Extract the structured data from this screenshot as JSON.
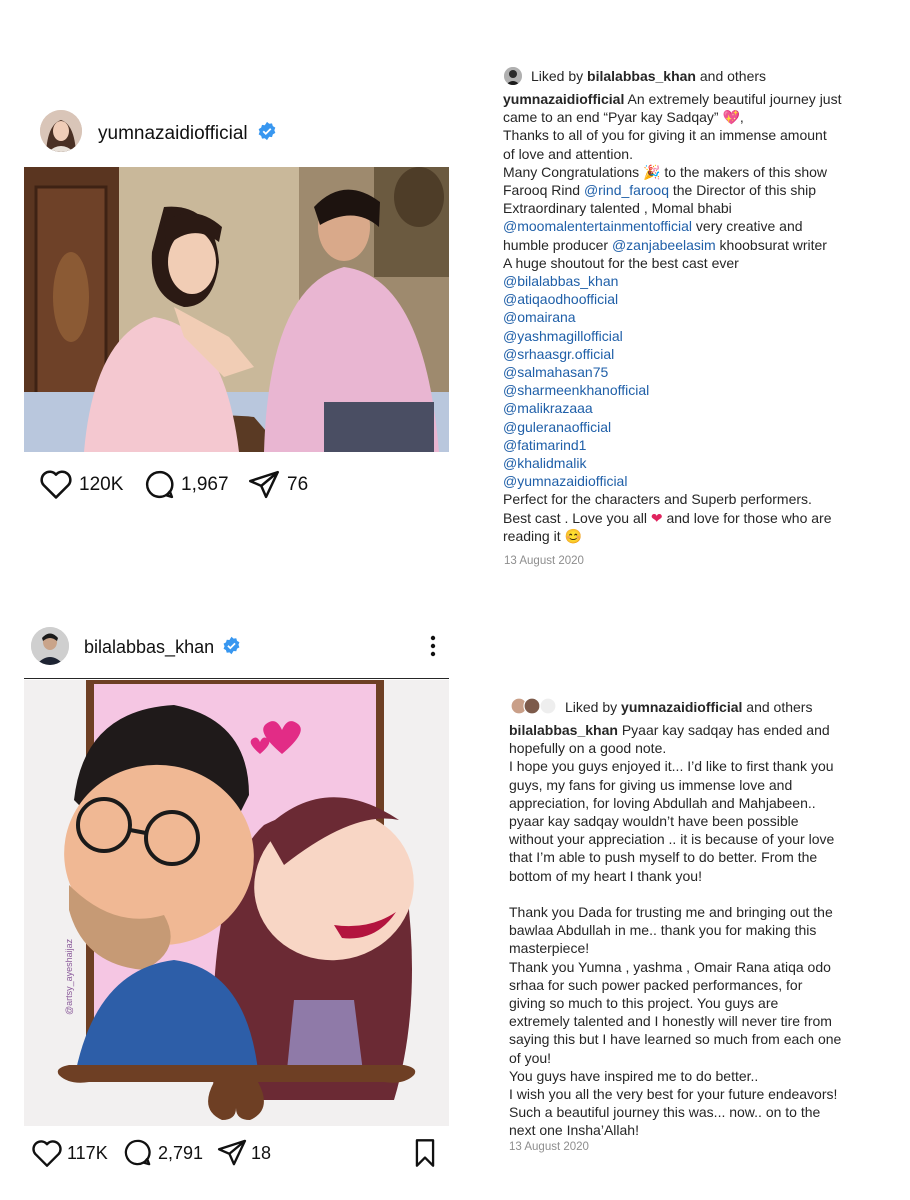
{
  "post1": {
    "username": "yumnazaidiofficial",
    "likes": "120K",
    "comments": "1,967",
    "shares": "76",
    "liked_by_prefix": "Liked by ",
    "liked_by_user": "bilalabbas_khan",
    "liked_by_suffix": " and others",
    "caption_user": "yumnazaidiofficial",
    "caption_lines": [
      {
        "t": " An extremely beautiful journey just"
      },
      {
        "t": "came to an end “Pyar kay Sadqay” 💖,"
      },
      {
        "t": "Thanks to all of you for giving it an immense amount"
      },
      {
        "t": "of love and attention."
      },
      {
        "t": "Many Congratulations 🎉 to the makers of this show"
      }
    ],
    "line_farooq_a": "Farooq Rind ",
    "line_farooq_m": "@rind_farooq",
    "line_farooq_b": " the Director of this ship",
    "line_extra": "Extraordinary talented , Momal bhabi",
    "line_moomal_m": "@moomalentertainmentofficial",
    "line_moomal_b": " very creative and",
    "line_humble_a": "humble producer ",
    "line_humble_m": "@zanjabeelasim",
    "line_humble_b": " khoobsurat writer",
    "line_shoutout": "A huge shoutout for the best cast ever",
    "mentions": [
      "@bilalabbas_khan",
      "@atiqaodhoofficial",
      "@omairana",
      "@yashmagillofficial",
      "@srhaasgr.official",
      "@salmahasan75",
      "@sharmeenkhanofficial",
      "@malikrazaaa",
      "@guleranaofficial",
      "@fatimarind1",
      "@khalidmalik",
      "@yumnazaidiofficial"
    ],
    "line_perfect": "Perfect for the characters and Superb performers.",
    "line_best_a": "Best cast . Love you all ",
    "line_best_b": " and love for those who are",
    "line_reading": "reading it 😊",
    "date": "13 August 2020"
  },
  "post2": {
    "username": "bilalabbas_khan",
    "likes": "117K",
    "comments": "2,791",
    "shares": "18",
    "liked_by_prefix": "Liked by ",
    "liked_by_user": "yumnazaidiofficial",
    "liked_by_suffix": " and others",
    "caption_user": "bilalabbas_khan",
    "caption_lines": [
      " Pyaar kay sadqay has ended and",
      "hopefully on a good note.",
      "I hope you guys enjoyed it... I’d like to first thank you",
      "guys, my fans for giving us immense love and",
      "appreciation, for loving Abdullah and Mahjabeen..",
      "pyaar kay sadqay wouldn’t have been possible",
      "without your appreciation .. it is because of your love",
      "that I’m able to push myself to do better. From the",
      "bottom of my heart I thank you!",
      "",
      "Thank you Dada for trusting me and bringing out the",
      "bawlaa Abdullah in me.. thank you for making this",
      "masterpiece!",
      "Thank you Yumna , yashma , Omair Rana atiqa odo",
      "srhaa for such power packed performances, for",
      "giving so much to this project. You guys are",
      "extremely talented and I honestly will never tire from",
      "saying this but I have learned so much from each one",
      "of you!",
      "You guys have inspired me to do better..",
      "I wish you all the very best for your future endeavors!",
      "Such a beautiful journey this was... now.. on to the",
      "next one Insha’Allah!"
    ],
    "artist_watermark": "@artsy_ayeshaijaz",
    "date": "13 August 2020"
  },
  "colors": {
    "verified": "#3897f0",
    "mention": "#1f5fa8",
    "heart": "#e0245e"
  }
}
